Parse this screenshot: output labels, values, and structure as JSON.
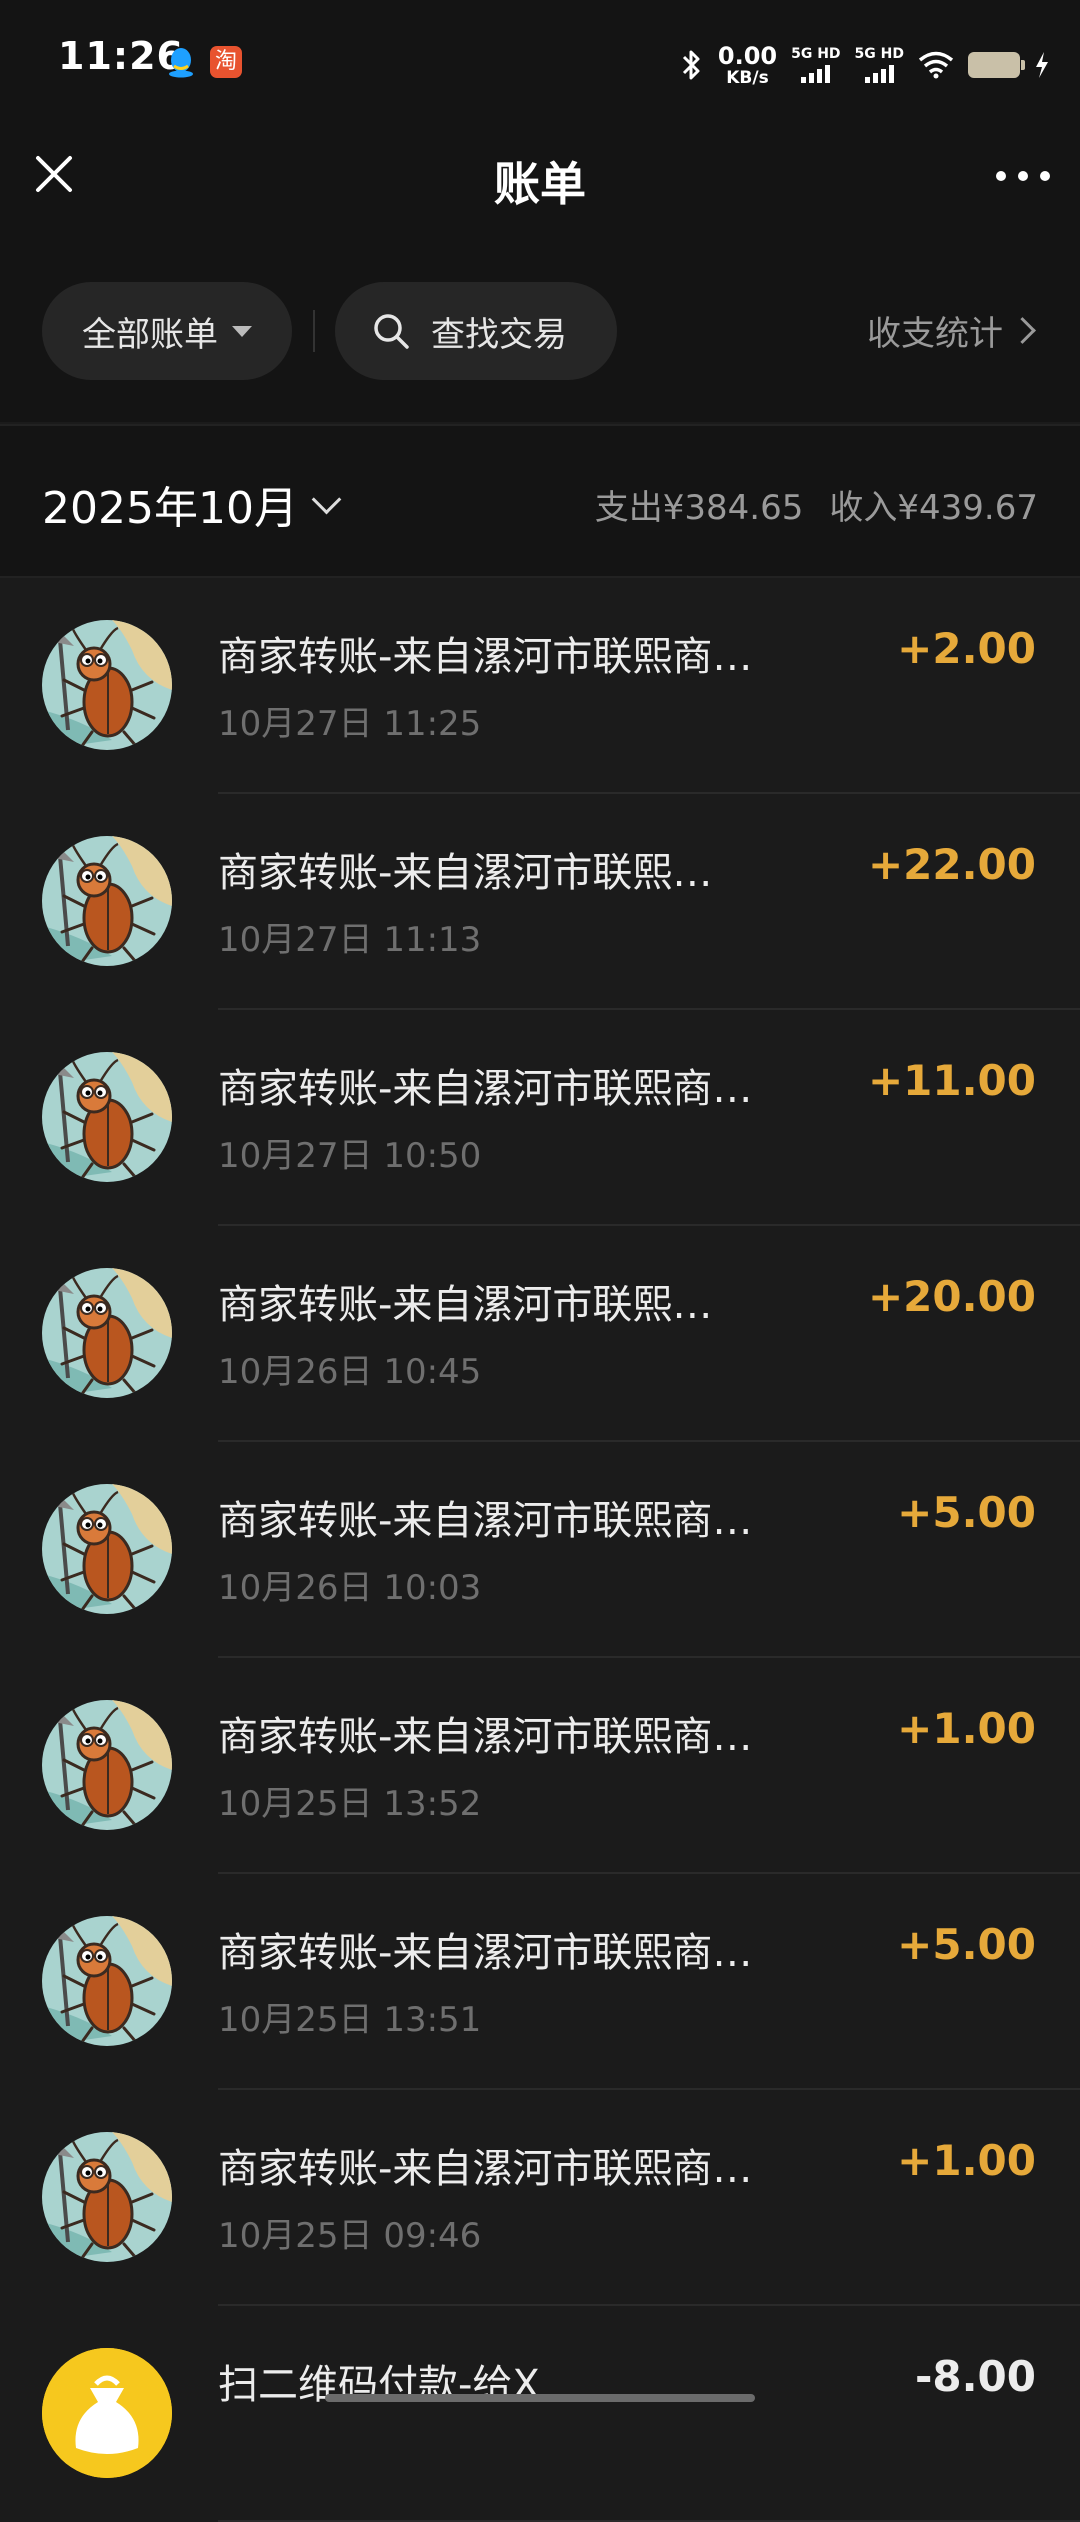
{
  "status": {
    "time": "11:26",
    "taobao_glyph": "淘",
    "net_speed": "0.00",
    "net_unit": "KB/s",
    "sim1": "5G HD",
    "sim2": "5G HD",
    "icons": [
      "qq-icon",
      "taobao-icon",
      "bluetooth-icon",
      "signal-icon",
      "wifi-icon",
      "battery-icon",
      "charging-icon"
    ]
  },
  "header": {
    "title": "账单"
  },
  "filters": {
    "all_bills": "全部账单",
    "search": "查找交易",
    "stats": "收支统计"
  },
  "month": {
    "label": "2025年10月",
    "expense": "支出¥384.65",
    "income": "收入¥439.67"
  },
  "colors": {
    "income": "#e6a93a",
    "background": "#1b1b1b",
    "qr_avatar": "#f6c81e"
  },
  "transactions": [
    {
      "title": "商家转账-来自漯河市联熙商…",
      "time": "10月27日 11:25",
      "amount": "+2.00",
      "avatar": "cockroach-avatar"
    },
    {
      "title": "商家转账-来自漯河市联熙…",
      "time": "10月27日 11:13",
      "amount": "+22.00",
      "avatar": "cockroach-avatar"
    },
    {
      "title": "商家转账-来自漯河市联熙商…",
      "time": "10月27日 10:50",
      "amount": "+11.00",
      "avatar": "cockroach-avatar"
    },
    {
      "title": "商家转账-来自漯河市联熙…",
      "time": "10月26日 10:45",
      "amount": "+20.00",
      "avatar": "cockroach-avatar"
    },
    {
      "title": "商家转账-来自漯河市联熙商…",
      "time": "10月26日 10:03",
      "amount": "+5.00",
      "avatar": "cockroach-avatar"
    },
    {
      "title": "商家转账-来自漯河市联熙商…",
      "time": "10月25日 13:52",
      "amount": "+1.00",
      "avatar": "cockroach-avatar"
    },
    {
      "title": "商家转账-来自漯河市联熙商…",
      "time": "10月25日 13:51",
      "amount": "+5.00",
      "avatar": "cockroach-avatar"
    },
    {
      "title": "商家转账-来自漯河市联熙商…",
      "time": "10月25日 09:46",
      "amount": "+1.00",
      "avatar": "cockroach-avatar"
    },
    {
      "title": "扫二维码付款-给X",
      "time": "",
      "amount": "-8.00",
      "avatar": "money-bag-avatar"
    }
  ]
}
